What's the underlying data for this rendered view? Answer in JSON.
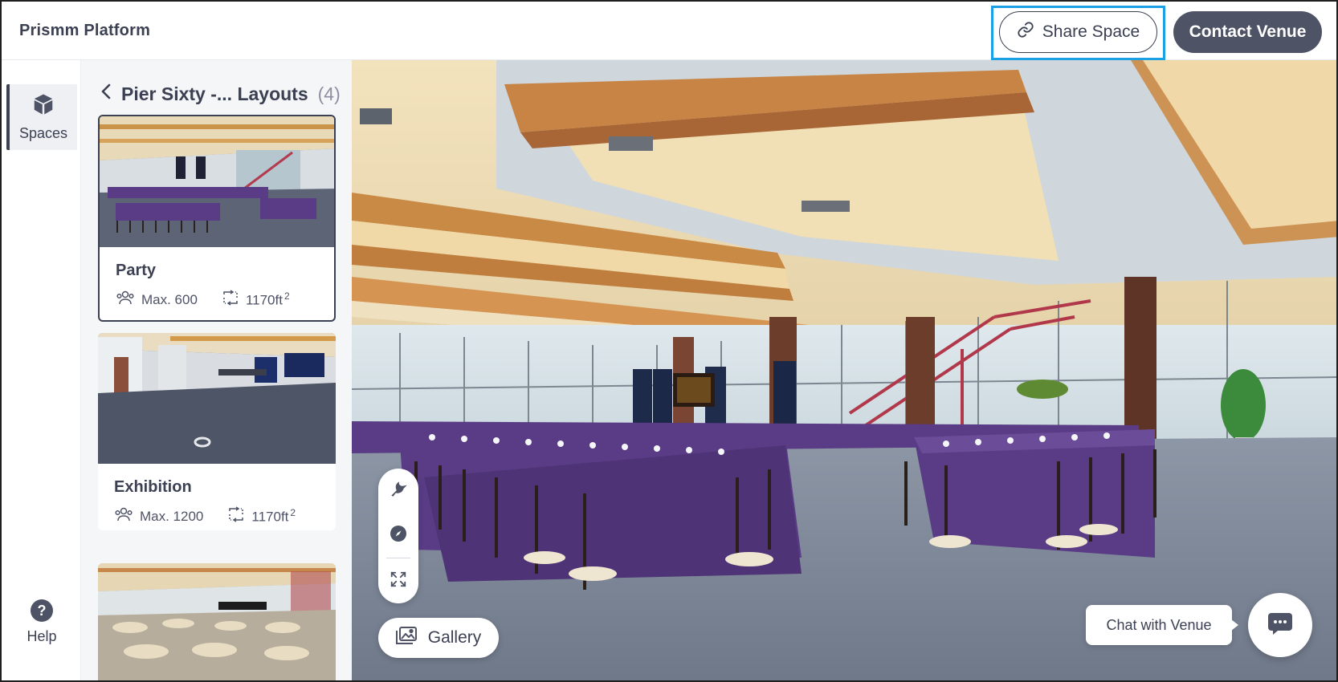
{
  "header": {
    "app_title": "Prismm Platform",
    "share_label": "Share Space",
    "contact_label": "Contact Venue"
  },
  "rail": {
    "spaces_label": "Spaces",
    "help_label": "Help"
  },
  "panel": {
    "title": "Pier Sixty -... Layouts",
    "count": "(4)",
    "layouts": [
      {
        "name": "Party",
        "capacity": "Max. 600",
        "area": "1170ft",
        "area_unit_sup": "2",
        "selected": true
      },
      {
        "name": "Exhibition",
        "capacity": "Max. 1200",
        "area": "1170ft",
        "area_unit_sup": "2",
        "selected": false
      }
    ]
  },
  "viewer": {
    "gallery_label": "Gallery",
    "chat_label": "Chat with Venue"
  },
  "colors": {
    "accent_dark": "#4f5366",
    "highlight": "#1ba0e6",
    "tablecloth": "#5a3c86"
  }
}
